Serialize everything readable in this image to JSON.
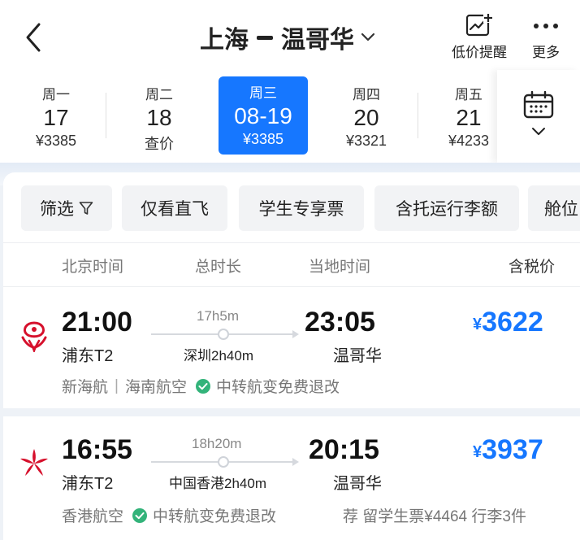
{
  "header": {
    "origin": "上海",
    "destination": "温哥华",
    "price_alert_label": "低价提醒",
    "more_label": "更多"
  },
  "dates": [
    {
      "weekday": "周一",
      "day": "17",
      "price": "¥3385"
    },
    {
      "weekday": "周二",
      "day": "18",
      "price": "查价"
    },
    {
      "weekday": "周三",
      "day": "08-19",
      "price": "¥3385",
      "selected": true
    },
    {
      "weekday": "周四",
      "day": "20",
      "price": "¥3321"
    },
    {
      "weekday": "周五",
      "day": "21",
      "price": "¥4233"
    }
  ],
  "filters": [
    "筛选",
    "仅看直飞",
    "学生专享票",
    "含托运行李额",
    "舱位"
  ],
  "columns": {
    "beijing_time": "北京时间",
    "total_duration": "总时长",
    "local_time": "当地时间",
    "tax_included": "含税价"
  },
  "flights": [
    {
      "depart_time": "21:00",
      "depart_airport": "浦东T2",
      "duration": "17h5m",
      "transfer": "深圳2h40m",
      "arrive_time": "23:05",
      "arrive_airport": "温哥华",
      "currency": "¥",
      "price": "3622",
      "airlines": [
        "新海航",
        "海南航空"
      ],
      "perk": "中转航变免费退改",
      "logo": "hainan-airlines-logo"
    },
    {
      "depart_time": "16:55",
      "depart_airport": "浦东T2",
      "duration": "18h20m",
      "transfer": "中国香港2h40m",
      "arrive_time": "20:15",
      "arrive_airport": "温哥华",
      "currency": "¥",
      "price": "3937",
      "airlines": [
        "香港航空"
      ],
      "perk": "中转航变免费退改",
      "recommendation": "荐 留学生票¥4464 行李3件",
      "logo": "hongkong-airlines-logo"
    }
  ],
  "colors": {
    "accent": "#1677ff",
    "check": "#33b37a",
    "logo_red": "#d6102c"
  }
}
